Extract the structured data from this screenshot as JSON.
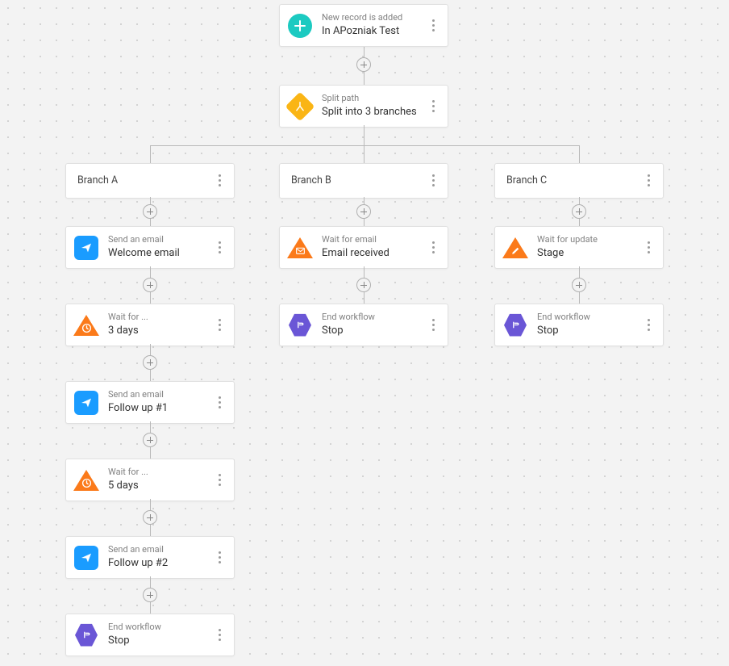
{
  "colors": {
    "trigger": "#1ccac1",
    "split": "#fab515",
    "email": "#1a9cff",
    "wait": "#fb7a1a",
    "end": "#6a56d6"
  },
  "trigger": {
    "eyebrow": "New record is added",
    "title": "In APozniak Test"
  },
  "split": {
    "eyebrow": "Split path",
    "title": "Split into 3 branches"
  },
  "branches": {
    "a": {
      "label": "Branch A",
      "nodes": [
        {
          "eyebrow": "Send an email",
          "title": "Welcome email",
          "icon": "email"
        },
        {
          "eyebrow": "Wait for ...",
          "title": "3 days",
          "icon": "wait-clock"
        },
        {
          "eyebrow": "Send an email",
          "title": "Follow up #1",
          "icon": "email"
        },
        {
          "eyebrow": "Wait for ...",
          "title": "5 days",
          "icon": "wait-clock"
        },
        {
          "eyebrow": "Send an email",
          "title": "Follow up #2",
          "icon": "email"
        },
        {
          "eyebrow": "End workflow",
          "title": "Stop",
          "icon": "end"
        }
      ]
    },
    "b": {
      "label": "Branch B",
      "nodes": [
        {
          "eyebrow": "Wait for email",
          "title": "Email received",
          "icon": "wait-mail"
        },
        {
          "eyebrow": "End workflow",
          "title": "Stop",
          "icon": "end"
        }
      ]
    },
    "c": {
      "label": "Branch C",
      "nodes": [
        {
          "eyebrow": "Wait for update",
          "title": "Stage",
          "icon": "wait-edit"
        },
        {
          "eyebrow": "End workflow",
          "title": "Stop",
          "icon": "end"
        }
      ]
    }
  }
}
